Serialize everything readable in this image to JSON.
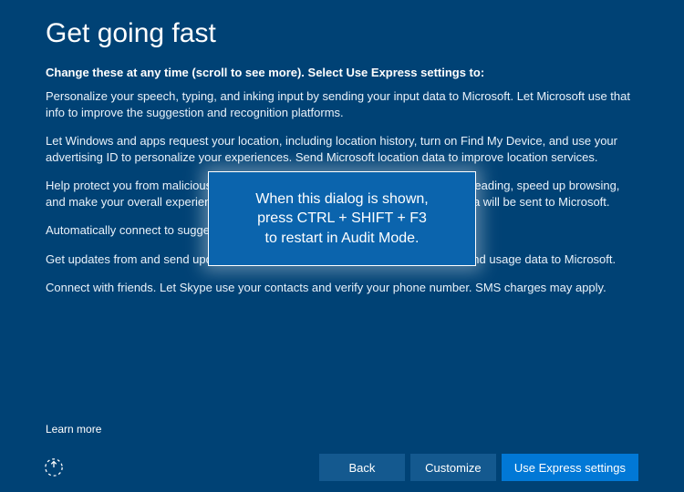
{
  "title": "Get going fast",
  "subheading": "Change these at any time (scroll to see more). Select Use Express settings to:",
  "paragraphs": {
    "p0": "Personalize your speech, typing, and inking input by sending your input data to Microsoft. Let Microsoft use that info to improve the suggestion and recognition platforms.",
    "p1": "Let Windows and apps request your location, including location history, turn on Find My Device, and use your advertising ID to personalize your experiences. Send Microsoft location data to improve location services.",
    "p2": "Help protect you from malicious web content and use page prediction to improve reading, speed up browsing, and make your overall experience better in Windows browsers. Your browsing data will be sent to Microsoft.",
    "p3": "Automatically connect to suggested open hotspots. Not all networks are secure.",
    "p4": "Get updates from and send updates to PCs on the Internet. Send full diagnostic and usage data to Microsoft.",
    "p5": "Connect with friends. Let Skype use your contacts and verify your phone number. SMS charges may apply."
  },
  "learn_more": "Learn more",
  "buttons": {
    "back": "Back",
    "customize": "Customize",
    "express": "Use Express settings"
  },
  "overlay": {
    "line1": "When this dialog is shown,",
    "line2": "press CTRL + SHIFT + F3",
    "line3": "to restart in Audit Mode."
  }
}
